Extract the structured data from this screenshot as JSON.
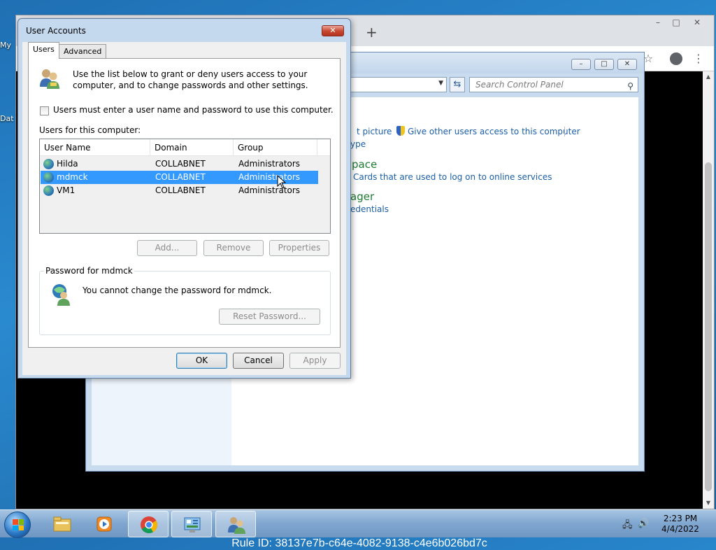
{
  "desktop": {
    "fragments": [
      "My",
      "Dat"
    ]
  },
  "chrome": {
    "new_tab": "+",
    "minimize": "–",
    "maximize": "□",
    "close": "✕",
    "rule_id": "Rule ID: 38137e7b-c64e-4082-9138-c4e6b026bd7c"
  },
  "control_panel": {
    "minimize": "–",
    "maximize": "□",
    "close": "✕",
    "search_placeholder": "Search Control Panel",
    "links": {
      "picture": "t picture",
      "give_access": "Give other users access to this computer",
      "type": "ype",
      "workspace": "pace",
      "cards": "Cards that are used to log on to online services",
      "manager": "ager",
      "credentials": "edentials"
    }
  },
  "dialog": {
    "title": "User Accounts",
    "close": "✕",
    "tabs": [
      "Users",
      "Advanced"
    ],
    "intro": "Use the list below to grant or deny users access to your computer, and to change passwords and other settings.",
    "checkbox_label": "Users must enter a user name and password to use this computer.",
    "checkbox_checked": false,
    "list_label": "Users for this computer:",
    "columns": [
      "User Name",
      "Domain",
      "Group"
    ],
    "rows": [
      {
        "name": "Hilda",
        "domain": "COLLABNET",
        "group": "Administrators"
      },
      {
        "name": "mdmck",
        "domain": "COLLABNET",
        "group": "Administrators"
      },
      {
        "name": "VM1",
        "domain": "COLLABNET",
        "group": "Administrators"
      }
    ],
    "selected_row": 1,
    "buttons": {
      "add": "Add...",
      "remove": "Remove",
      "properties": "Properties",
      "reset_password": "Reset Password...",
      "ok": "OK",
      "cancel": "Cancel",
      "apply": "Apply"
    },
    "password_group": "Password for mdmck",
    "password_msg": "You cannot change the password for mdmck."
  },
  "taskbar": {
    "apps": [
      "explorer-icon",
      "media-player-icon",
      "chrome-icon",
      "control-panel-icon",
      "user-accounts-icon"
    ],
    "time": "2:23 PM",
    "date": "4/4/2022"
  }
}
